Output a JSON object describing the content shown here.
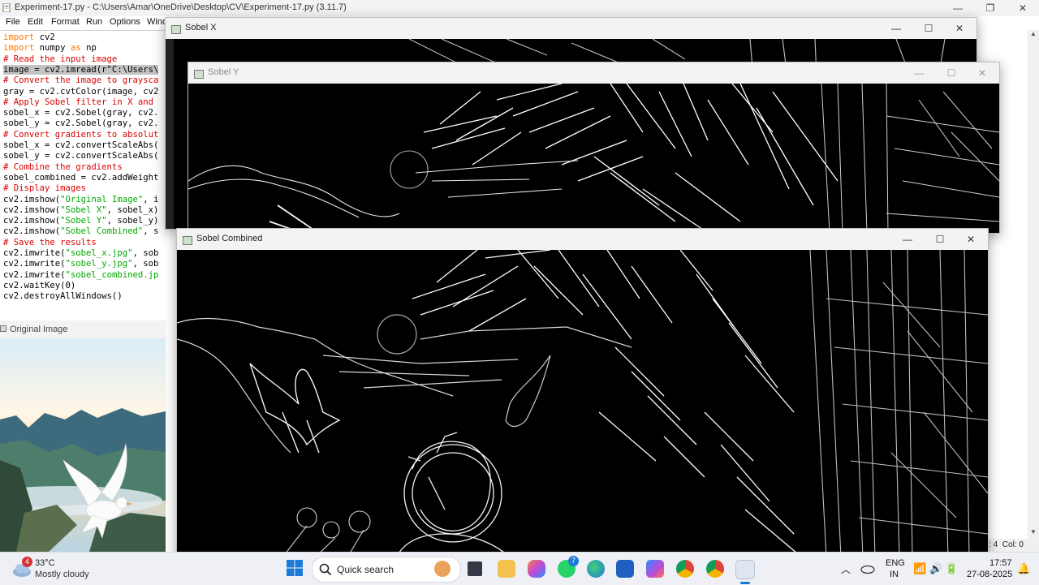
{
  "editor": {
    "title": "Experiment-17.py - C:\\Users\\Amar\\OneDrive\\Desktop\\CV\\Experiment-17.py (3.11.7)",
    "menu": [
      "File",
      "Edit",
      "Format",
      "Run",
      "Options",
      "Wind"
    ],
    "status": "Ln: 4  Col: 0",
    "code_lines": [
      [
        {
          "t": "import",
          "c": "kw"
        },
        {
          "t": " cv2"
        }
      ],
      [
        {
          "t": "import",
          "c": "kw"
        },
        {
          "t": " numpy "
        },
        {
          "t": "as",
          "c": "kw"
        },
        {
          "t": " np"
        }
      ],
      [
        {
          "t": "# Read the input image",
          "c": "cm"
        }
      ],
      [
        {
          "t": "image = cv2.imread(r\"C:\\Users\\",
          "c": "hl"
        }
      ],
      [
        {
          "t": "# Convert the image to graysca",
          "c": "cm"
        }
      ],
      [
        {
          "t": "gray = cv2.cvtColor(image, cv2"
        }
      ],
      [
        {
          "t": "# Apply Sobel filter in X and",
          "c": "cm"
        }
      ],
      [
        {
          "t": "sobel_x = cv2.Sobel(gray, cv2."
        }
      ],
      [
        {
          "t": "sobel_y = cv2.Sobel(gray, cv2."
        }
      ],
      [
        {
          "t": "# Convert gradients to absolut",
          "c": "cm"
        }
      ],
      [
        {
          "t": "sobel_x = cv2.convertScaleAbs("
        }
      ],
      [
        {
          "t": "sobel_y = cv2.convertScaleAbs("
        }
      ],
      [
        {
          "t": "# Combine the gradients",
          "c": "cm"
        }
      ],
      [
        {
          "t": "sobel_combined = cv2.addWeight"
        }
      ],
      [
        {
          "t": "# Display images",
          "c": "cm"
        }
      ],
      [
        {
          "t": "cv2.imshow("
        },
        {
          "t": "\"Original Image\"",
          "c": "st"
        },
        {
          "t": ", i"
        }
      ],
      [
        {
          "t": "cv2.imshow("
        },
        {
          "t": "\"Sobel X\"",
          "c": "st"
        },
        {
          "t": ", sobel_x)"
        }
      ],
      [
        {
          "t": "cv2.imshow("
        },
        {
          "t": "\"Sobel Y\"",
          "c": "st"
        },
        {
          "t": ", sobel_y)"
        }
      ],
      [
        {
          "t": "cv2.imshow("
        },
        {
          "t": "\"Sobel Combined\"",
          "c": "st"
        },
        {
          "t": ", s"
        }
      ],
      [
        {
          "t": "# Save the results",
          "c": "cm"
        }
      ],
      [
        {
          "t": "cv2.imwrite("
        },
        {
          "t": "\"sobel_x.jpg\"",
          "c": "st"
        },
        {
          "t": ", sob"
        }
      ],
      [
        {
          "t": "cv2.imwrite("
        },
        {
          "t": "\"sobel_y.jpg\"",
          "c": "st"
        },
        {
          "t": ", sob"
        }
      ],
      [
        {
          "t": "cv2.imwrite("
        },
        {
          "t": "\"sobel_combined.jp",
          "c": "st"
        }
      ],
      [
        {
          "t": "cv2.waitKey(0)"
        }
      ],
      [
        {
          "t": "cv2.destroyAllWindows()"
        }
      ]
    ]
  },
  "windows": {
    "original": "Original Image",
    "sobel_x": "Sobel X",
    "sobel_y": "Sobel Y",
    "sobel_combined": "Sobel Combined"
  },
  "taskbar": {
    "weather_temp": "33°C",
    "weather_desc": "Mostly cloudy",
    "weather_badge": "4",
    "search_label": "Quick search",
    "whatsapp_badge": "7",
    "lang": "ENG",
    "region": "IN",
    "time": "17:57",
    "date": "27-08-2025"
  },
  "colors": {
    "keyword": "#ff7700",
    "comment": "#dd0000",
    "string": "#00aa00",
    "taskbar": "#eef0f5"
  }
}
